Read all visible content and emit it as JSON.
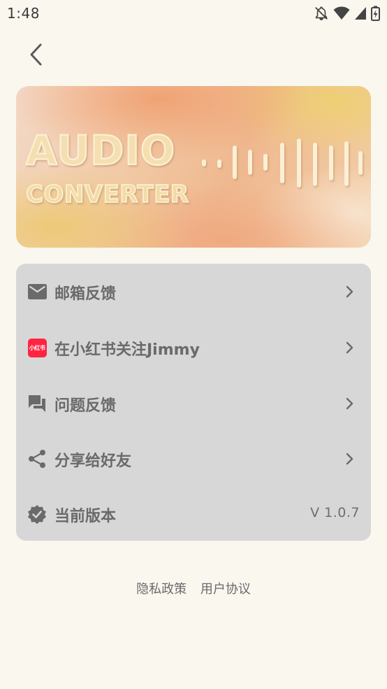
{
  "status_bar": {
    "time": "1:48",
    "icons": [
      "notifications-off-icon",
      "wifi-icon",
      "signal-icon",
      "battery-charging-icon"
    ]
  },
  "header": {
    "back_icon": "chevron-left-icon"
  },
  "banner": {
    "line1": "AUDIO",
    "line2": "CONVERTER",
    "colors": {
      "warm_orange": "#efb88f",
      "gold": "#edd06e",
      "peach": "#f3d9c7"
    }
  },
  "menu": {
    "items": [
      {
        "label": "邮箱反馈",
        "icon": "mail-icon",
        "chevron": true
      },
      {
        "label": "在小红书关注Jimmy",
        "icon": "xiaohongshu-icon",
        "icon_text": "小红书",
        "chevron": true
      },
      {
        "label": "问题反馈",
        "icon": "chat-bubbles-icon",
        "chevron": true
      },
      {
        "label": "分享给好友",
        "icon": "share-icon",
        "chevron": true
      },
      {
        "label": "当前版本",
        "icon": "verified-badge-icon",
        "value": "V 1.0.7",
        "chevron": false
      }
    ]
  },
  "footer": {
    "privacy_label": "隐私政策",
    "terms_label": "用户协议"
  },
  "colors": {
    "background": "#faf7ef",
    "card": "#d7d7d7",
    "text": "#6a6a6a",
    "xiaohongshu_red": "#ff2442"
  }
}
